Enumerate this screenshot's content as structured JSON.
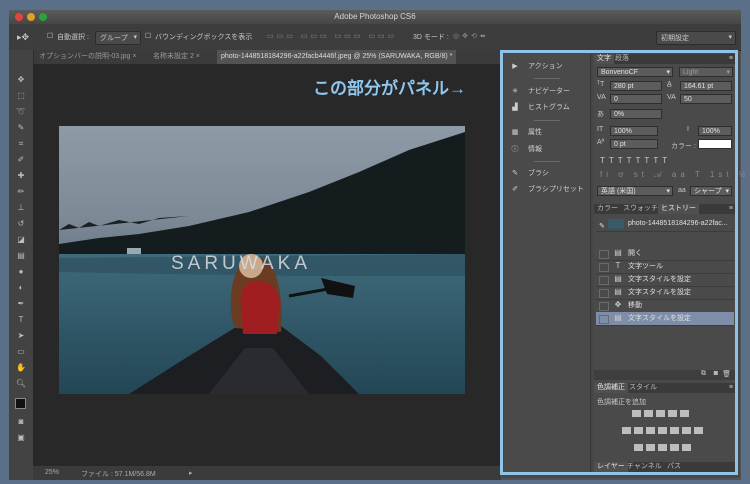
{
  "window": {
    "title": "Adobe Photoshop CS6"
  },
  "options_bar": {
    "auto_select_label": "自動選択 :",
    "auto_select_value": "グループ",
    "bounding_box_label": "バウンディングボックスを表示",
    "mode_3d_label": "3D モード :",
    "workspace_value": "初期設定"
  },
  "document_tabs": [
    "オプションバーの説明-03.jpg",
    "名称未設定 2",
    "photo-1448518184296-a22facb4446f.jpeg @ 25% (SARUWAKA, RGB/8) *"
  ],
  "canvas": {
    "overlay_text": "SARUWAKA"
  },
  "status_bar": {
    "zoom": "25%",
    "file_info": "ファイル : 57.1M/56.8M"
  },
  "callout": {
    "text": "この部分がパネル→"
  },
  "collapsed_panels": [
    {
      "label": "アクション",
      "icon": "play-icon"
    },
    {
      "label": "ナビゲーター",
      "icon": "navigator-icon"
    },
    {
      "label": "ヒストグラム",
      "icon": "histogram-icon"
    },
    {
      "label": "属性",
      "icon": "properties-icon"
    },
    {
      "label": "情報",
      "icon": "info-icon"
    },
    {
      "label": "ブラシ",
      "icon": "brush-icon"
    },
    {
      "label": "ブラシプリセット",
      "icon": "brush-preset-icon"
    }
  ],
  "character_panel": {
    "tabs": [
      "文字",
      "段落"
    ],
    "font_family": "BonvenoCF",
    "font_style": "Light",
    "font_size": "280 pt",
    "leading": "164.61 pt",
    "kerning": "0",
    "tracking": "50",
    "tsume": "0%",
    "vertical_scale": "100%",
    "horizontal_scale": "100%",
    "baseline_shift": "0 pt",
    "color_label": "カラー :",
    "color_value": "#ffffff",
    "language": "英語 (米国)",
    "aa_label": "aa",
    "antialias": "シャープ"
  },
  "history_panel": {
    "tabs": [
      "カラー",
      "スウォッチ",
      "ヒストリー"
    ],
    "snapshot": "photo-1448518184296-a22fac...",
    "items": [
      "開く",
      "文字ツール",
      "文字スタイルを設定",
      "文字スタイルを設定",
      "移動",
      "文字スタイルを設定"
    ]
  },
  "adjustments_panel": {
    "tabs": [
      "色調補正",
      "スタイル"
    ],
    "add_label": "色調補正を追加"
  },
  "layers_panel": {
    "tabs": [
      "レイヤー",
      "チャンネル",
      "パス"
    ]
  },
  "colors": {
    "highlight": "#8fc3e8",
    "history_selected": "#7e8ea8"
  }
}
